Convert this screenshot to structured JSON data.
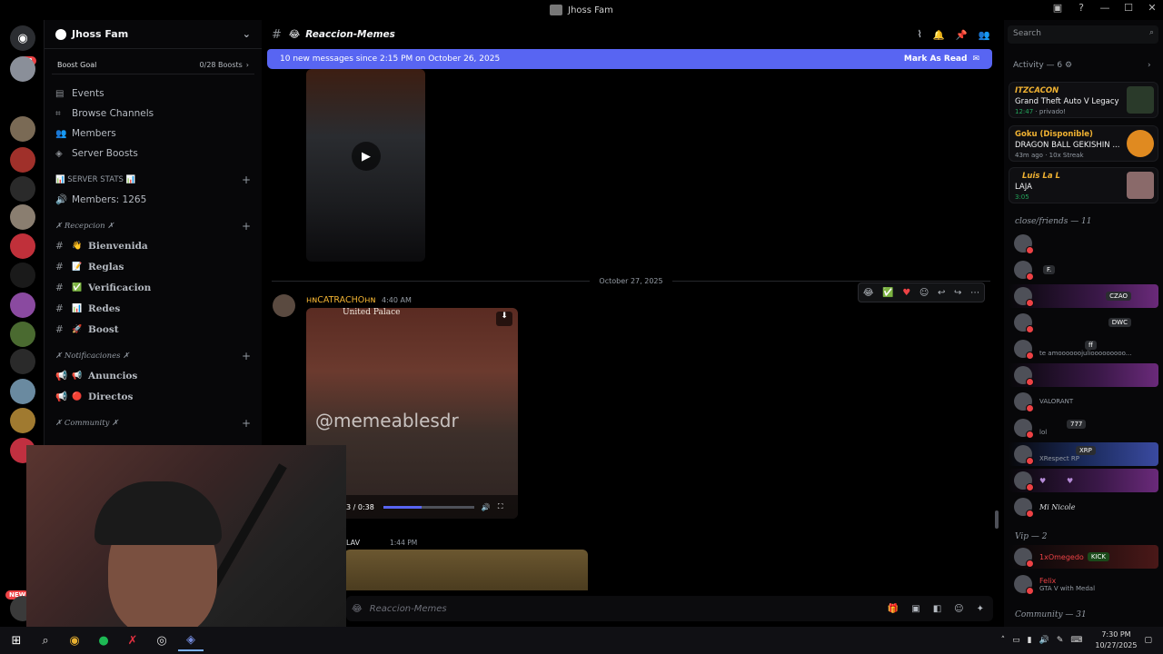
{
  "window": {
    "title": "Jhoss Fam"
  },
  "servers": {
    "unread_badge": "43",
    "new_badge": "NEW"
  },
  "guild": {
    "name": "Jhoss Fam",
    "boost_label": "Boost Goal",
    "boost_count": "0/28 Boosts",
    "nav": [
      {
        "icon": "▤",
        "label": "Events"
      },
      {
        "icon": "⌗",
        "label": "Browse Channels"
      },
      {
        "icon": "👥",
        "label": "Members"
      },
      {
        "icon": "◈",
        "label": "Server Boosts"
      }
    ],
    "stats_category": "📊 SERVER STATS 📊",
    "stats_channel": "Members: 1265",
    "recepcion_category": "✗ Recepcion ✗",
    "recepcion_channels": [
      {
        "emoji": "👋",
        "name": "Bienvenida"
      },
      {
        "emoji": "📝",
        "name": "Reglas"
      },
      {
        "emoji": "✅",
        "name": "Verificacion"
      },
      {
        "emoji": "📊",
        "name": "Redes"
      },
      {
        "emoji": "🚀",
        "name": "Boost"
      }
    ],
    "notificaciones_category": "✗ Notificaciones ✗",
    "notificaciones_channels": [
      {
        "emoji": "📢",
        "name": "Anuncios"
      },
      {
        "emoji": "🔴",
        "name": "Directos"
      }
    ],
    "community_category": "✗ Community ✗"
  },
  "channel": {
    "name": "Reaccion-Memes",
    "banner_text": "10 new messages since 2:15 PM on October 26, 2025",
    "mark_read": "Mark As Read",
    "date_divider": "October 27, 2025",
    "message": {
      "author": "нɴCATRACHOнɴ",
      "time": "4:40 AM",
      "video_caption": "United Palace",
      "watermark": "@memeablesdr",
      "video_time": "3 / 0:38",
      "progress": 0.42
    },
    "message2": {
      "author": "LAV",
      "time": "1:44 PM"
    },
    "composer_placeholder": "Reaccion-Memes"
  },
  "members": {
    "search_placeholder": "Search",
    "activity_header": "Activity — 6",
    "activities": [
      {
        "name": "ITZCACON",
        "title": "Grand Theft Auto V Legacy",
        "sub_time": "12:47",
        "sub_extra": "privado!"
      },
      {
        "name": "Goku (Disponible)",
        "title": "DRAGON BALL GEKISHIN ...",
        "sub_time": "43m ago",
        "sub_extra": "10x Streak"
      },
      {
        "name": "Luis La L",
        "title": "LAJA",
        "sub_time": "3:05",
        "sub_extra": ""
      }
    ],
    "group1": "close/friends — 11",
    "group1_members": [
      {
        "name": "",
        "tag": "",
        "status": ""
      },
      {
        "name": "",
        "tag": "F.",
        "status": ""
      },
      {
        "name": "",
        "tag": "CZAO",
        "status": ""
      },
      {
        "name": "",
        "tag": "DWC",
        "status": ""
      },
      {
        "name": "",
        "tag": "ff",
        "status": "te amoooooojuliooooooooo..."
      },
      {
        "name": "",
        "tag": "",
        "status": ""
      },
      {
        "name": "",
        "tag": "",
        "status": "VALORANT"
      },
      {
        "name": "",
        "tag": "777",
        "status": "lol"
      },
      {
        "name": "",
        "tag": "XRP",
        "status": "XRespect RP"
      },
      {
        "name": "",
        "tag": "",
        "status": ""
      },
      {
        "name": "Mi Nicole",
        "tag": "",
        "status": ""
      }
    ],
    "group2": "Vip — 2",
    "group2_members": [
      {
        "name": "1xOmegedo",
        "tag": "KICK",
        "status": ""
      },
      {
        "name": "Felix",
        "tag": "",
        "status": "GTA V with Medal"
      }
    ],
    "group3": "Community — 31"
  },
  "taskbar": {
    "time": "7:30 PM",
    "date": "10/27/2025"
  }
}
